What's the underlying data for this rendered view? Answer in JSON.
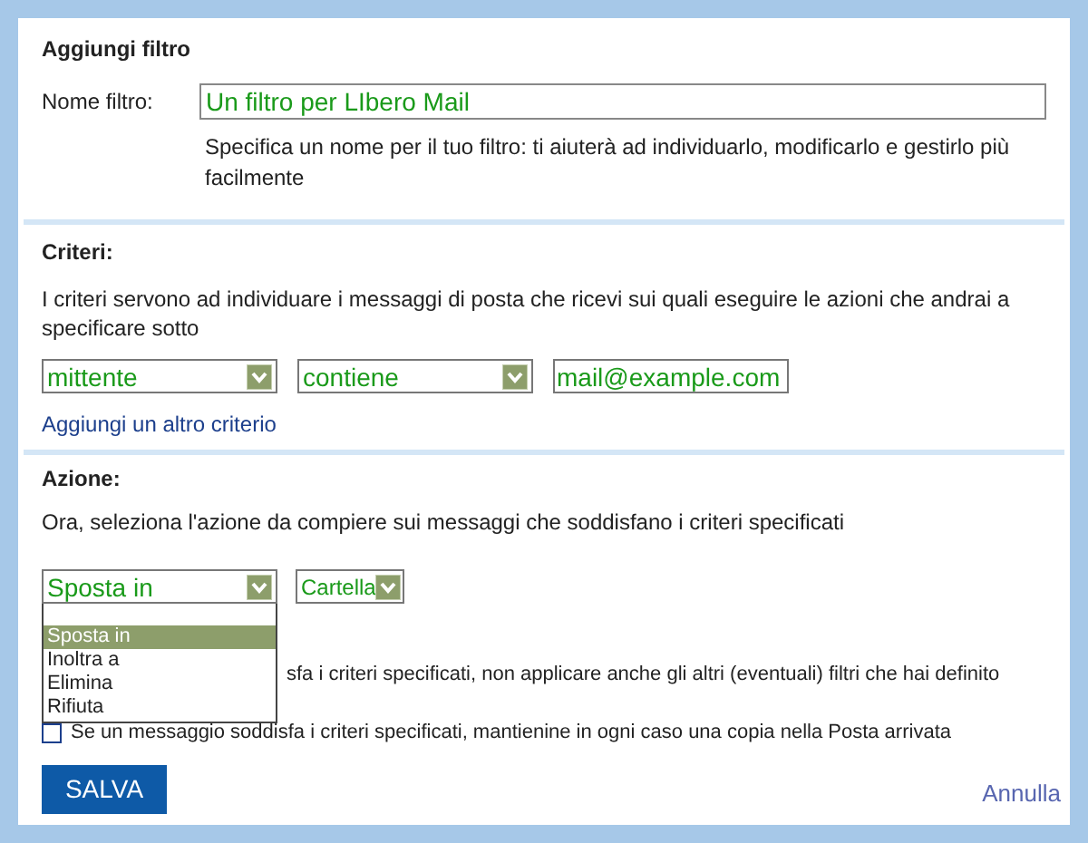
{
  "title": "Aggiungi filtro",
  "name_field": {
    "label": "Nome filtro:",
    "value": "Un filtro per LIbero Mail",
    "hint": "Specifica un nome per il tuo filtro: ti aiuterà ad individuarlo, modificarlo e gestirlo più facilmente"
  },
  "criteria": {
    "heading": "Criteri:",
    "description": "I criteri servono ad individuare i messaggi di posta che ricevi sui quali eseguire le azioni che andrai a specificare sotto",
    "field_select": "mittente",
    "operator_select": "contiene",
    "value": "mail@example.com",
    "add_link": "Aggiungi un altro criterio"
  },
  "action": {
    "heading": "Azione:",
    "description": "Ora, seleziona l'azione da compiere sui messaggi che soddisfano i criteri specificati",
    "action_select": "Sposta in",
    "folder_select": "Cartella",
    "dropdown_options": [
      {
        "label": "Sposta in",
        "selected": true
      },
      {
        "label": "Inoltra a",
        "selected": false
      },
      {
        "label": "Elimina",
        "selected": false
      },
      {
        "label": "Rifiuta",
        "selected": false
      }
    ]
  },
  "options": [
    {
      "text": "sfa i criteri specificati, non applicare anche gli altri (eventuali) filtri che hai definito",
      "kind": "covered"
    },
    {
      "text": "Se un messaggio soddisfa i criteri specificati, mantienine in ogni caso una copia nella Posta arrivata",
      "kind": "checkbox",
      "checked": false
    }
  ],
  "buttons": {
    "save": "SALVA",
    "cancel": "Annulla"
  }
}
